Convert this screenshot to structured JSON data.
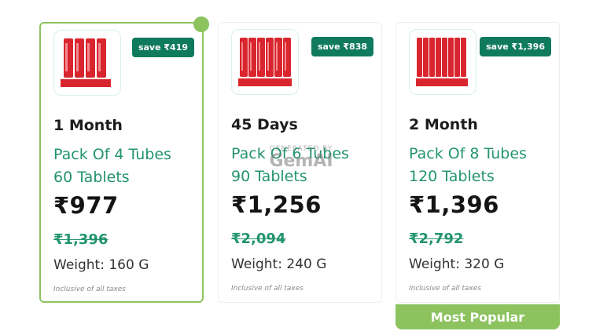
{
  "plans": [
    {
      "save_label": "save ₹419",
      "duration": "1 Month",
      "pack_line1": "Pack Of 4 Tubes",
      "pack_line2": "60 Tablets",
      "price": "₹977",
      "mrp": "₹1,396",
      "weight": "Weight: 160 G",
      "tax_note": "Inclusive of all taxes",
      "tube_count": 4,
      "selected": true
    },
    {
      "save_label": "save ₹838",
      "duration": "45 Days",
      "pack_line1": "Pack Of 6 Tubes",
      "pack_line2": "90 Tablets",
      "price": "₹1,256",
      "mrp": "₹2,094",
      "weight": "Weight: 240 G",
      "tax_note": "Inclusive of all taxes",
      "tube_count": 6,
      "selected": false
    },
    {
      "save_label": "save ₹1,396",
      "duration": "2 Month",
      "pack_line1": "Pack Of 8 Tubes",
      "pack_line2": "120 Tablets",
      "price": "₹1,396",
      "mrp": "₹2,792",
      "weight": "Weight: 320 G",
      "tax_note": "Inclusive of all taxes",
      "tube_count": 8,
      "selected": false
    }
  ],
  "popular_label": "Most Popular",
  "watermark": {
    "line1": "GENERATED BY",
    "line2": "GemAI"
  },
  "colors": {
    "accent_green": "#23946f",
    "badge_green": "#107a5e",
    "selected_border": "#8cc35f",
    "tube_red": "#d9262e"
  }
}
